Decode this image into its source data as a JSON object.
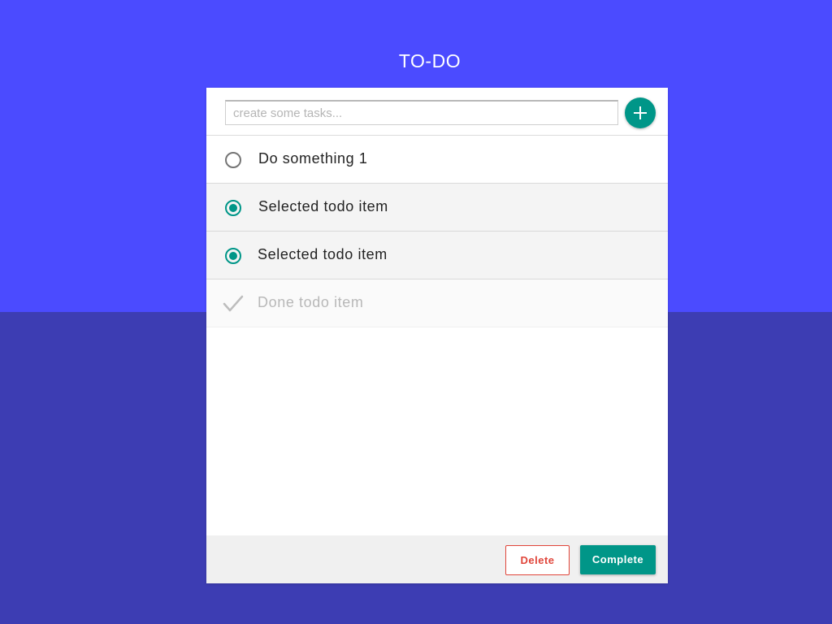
{
  "header": {
    "title": "TO-DO"
  },
  "input": {
    "value": "",
    "placeholder": "create some tasks..."
  },
  "add_button": {
    "icon": "plus-icon"
  },
  "todos": [
    {
      "label": "Do something 1",
      "state": "unselected",
      "icon": "radio-unchecked-icon"
    },
    {
      "label": "Selected todo item",
      "state": "selected",
      "icon": "radio-checked-icon"
    },
    {
      "label": "Selected todo item",
      "state": "selected",
      "icon": "radio-checked-icon"
    },
    {
      "label": "Done todo item",
      "state": "done",
      "icon": "checkmark-icon"
    }
  ],
  "footer": {
    "delete_label": "Delete",
    "complete_label": "Complete"
  },
  "colors": {
    "background_top": "#4b4bff",
    "background_bottom": "#3d3db3",
    "accent": "#009688",
    "danger": "#e0453a",
    "done_text": "#b8b8b8"
  }
}
